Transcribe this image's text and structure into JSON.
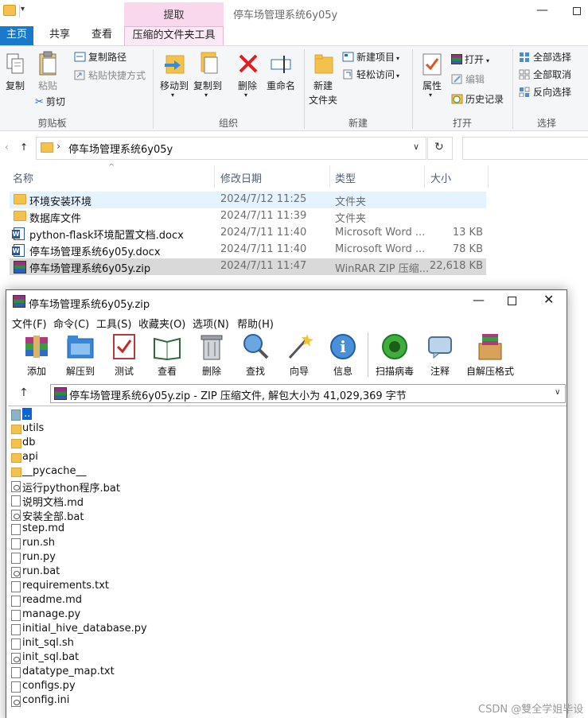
{
  "explorer": {
    "title": "停车场管理系统6y05y",
    "context_tab": "提取",
    "tabs": [
      "主页",
      "共享",
      "查看",
      "压缩的文件夹工具"
    ],
    "ribbon": {
      "clipboard": {
        "copy": "复制",
        "paste": "粘贴",
        "copy_path": "复制路径",
        "paste_shortcut": "粘贴快捷方式",
        "cut": "剪切",
        "label": "剪贴板"
      },
      "organize": {
        "move_to": "移动到",
        "copy_to": "复制到",
        "delete": "删除",
        "rename": "重命名",
        "label": "组织"
      },
      "new": {
        "new_folder_l1": "新建",
        "new_folder_l2": "文件夹",
        "new_item": "新建项目",
        "easy_access": "轻松访问",
        "label": "新建"
      },
      "open": {
        "properties": "属性",
        "open": "打开",
        "edit": "编辑",
        "history": "历史记录",
        "label": "打开"
      },
      "select": {
        "select_all": "全部选择",
        "select_none": "全部取消",
        "invert": "反向选择",
        "label": "选择"
      }
    },
    "address": {
      "path": "停车场管理系统6y05y"
    },
    "columns": {
      "name": "名称",
      "date": "修改日期",
      "type": "类型",
      "size": "大小"
    },
    "files": [
      {
        "name": "环境安装环境",
        "date": "2024/7/12 11:25",
        "type": "文件夹",
        "size": "",
        "icon": "folder-icon"
      },
      {
        "name": "数据库文件",
        "date": "2024/7/11 11:39",
        "type": "文件夹",
        "size": "",
        "icon": "folder-icon"
      },
      {
        "name": "python-flask环境配置文档.docx",
        "date": "2024/7/11 11:40",
        "type": "Microsoft Word ...",
        "size": "13 KB",
        "icon": "word-icon"
      },
      {
        "name": "停车场管理系统6y05y.docx",
        "date": "2024/7/11 11:40",
        "type": "Microsoft Word ...",
        "size": "78 KB",
        "icon": "word-icon"
      },
      {
        "name": "停车场管理系统6y05y.zip",
        "date": "2024/7/11 11:47",
        "type": "WinRAR ZIP 压缩...",
        "size": "22,618 KB",
        "icon": "winrar-icon"
      }
    ]
  },
  "winrar": {
    "title": "停车场管理系统6y05y.zip",
    "menu": [
      "文件(F)",
      "命令(C)",
      "工具(S)",
      "收藏夹(O)",
      "选项(N)",
      "帮助(H)"
    ],
    "toolbar": [
      "添加",
      "解压到",
      "测试",
      "查看",
      "删除",
      "查找",
      "向导",
      "信息",
      "扫描病毒",
      "注释",
      "自解压格式"
    ],
    "path_text": "停车场管理系统6y05y.zip - ZIP 压缩文件, 解包大小为 41,029,369 字节",
    "entries": [
      {
        "name": "..",
        "kind": "up"
      },
      {
        "name": "utils",
        "kind": "folder"
      },
      {
        "name": "db",
        "kind": "folder"
      },
      {
        "name": "api",
        "kind": "folder"
      },
      {
        "name": "__pycache__",
        "kind": "folder"
      },
      {
        "name": "运行python程序.bat",
        "kind": "bat"
      },
      {
        "name": "说明文档.md",
        "kind": "file"
      },
      {
        "name": "安装全部.bat",
        "kind": "bat"
      },
      {
        "name": "step.md",
        "kind": "file"
      },
      {
        "name": "run.sh",
        "kind": "file"
      },
      {
        "name": "run.py",
        "kind": "file"
      },
      {
        "name": "run.bat",
        "kind": "bat"
      },
      {
        "name": "requirements.txt",
        "kind": "file"
      },
      {
        "name": "readme.md",
        "kind": "file"
      },
      {
        "name": "manage.py",
        "kind": "file"
      },
      {
        "name": "initial_hive_database.py",
        "kind": "file"
      },
      {
        "name": "init_sql.sh",
        "kind": "file"
      },
      {
        "name": "init_sql.bat",
        "kind": "bat"
      },
      {
        "name": "datatype_map.txt",
        "kind": "file"
      },
      {
        "name": "configs.py",
        "kind": "file"
      },
      {
        "name": "config.ini",
        "kind": "bat"
      }
    ]
  },
  "watermark": "CSDN @雙全学姐毕设"
}
